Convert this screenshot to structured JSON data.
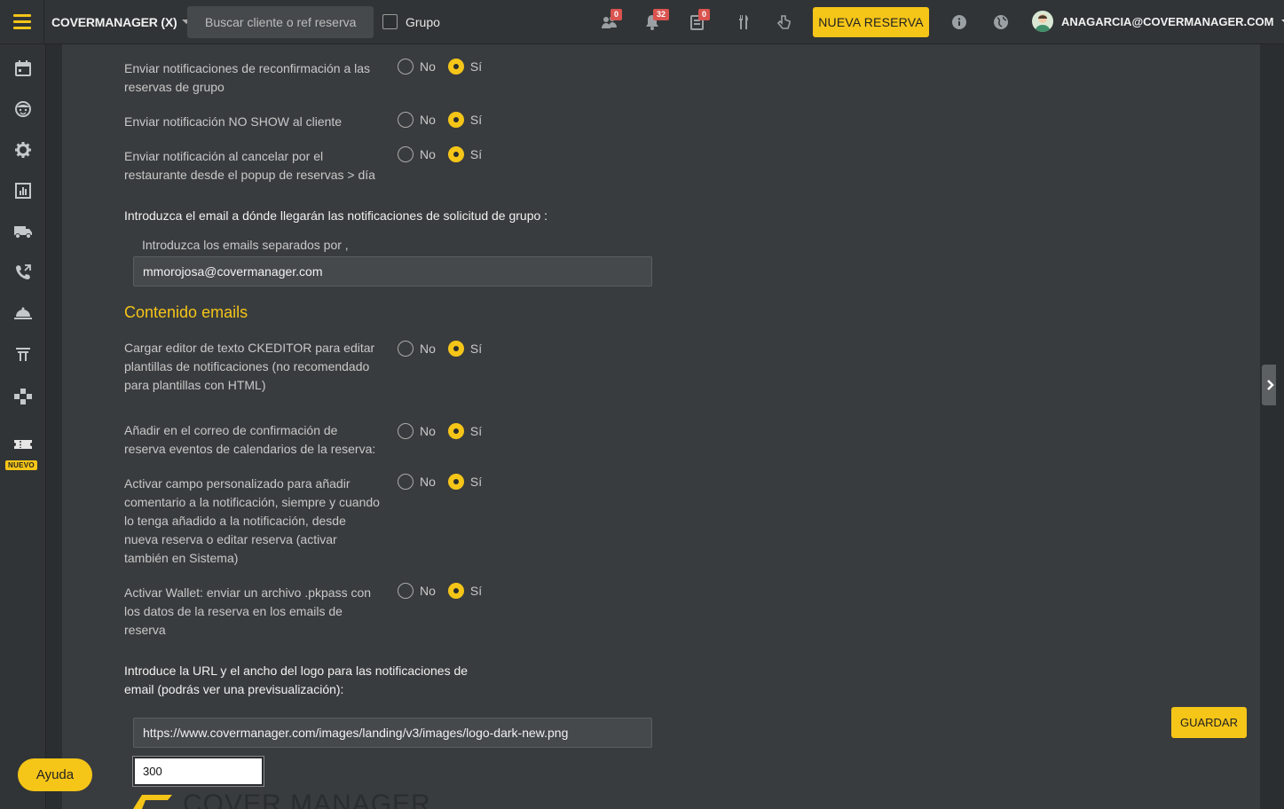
{
  "topbar": {
    "brand": "COVERMANAGER (X)",
    "search_placeholder": "Buscar cliente o ref reserva",
    "grupo_label": "Grupo",
    "badges": {
      "groups": "0",
      "alerts": "32",
      "tasks": "0"
    },
    "new_booking_label": "NUEVA RESERVA",
    "user_email": "ANAGARCIA@COVERMANAGER.COM"
  },
  "sidebar": {
    "items": [
      "calendar-icon",
      "face-icon",
      "gear-icon",
      "chart-icon",
      "truck-icon",
      "phone-icon",
      "cloche-icon",
      "pergola-icon",
      "gamepad-icon",
      "ticket-icon"
    ],
    "new_tag": "NUEVO"
  },
  "radio_labels": {
    "no": "No",
    "yes": "Sí"
  },
  "settings_top": [
    {
      "label": "Enviar notificaciones de reconfirmación a las reservas de grupo",
      "value": "Sí"
    },
    {
      "label": "Enviar notificación NO SHOW al cliente",
      "value": "Sí"
    },
    {
      "label": "Enviar notificación al cancelar por el restaurante desde el popup de reservas > día",
      "value": "Sí"
    }
  ],
  "group_email": {
    "heading": "Introduzca el email a dónde llegarán las notificaciones de solicitud de grupo :",
    "hint": "Introduzca los emails separados por ,",
    "value": "mmorojosa@covermanager.com"
  },
  "section_title": "Contenido emails",
  "settings_emails": [
    {
      "label": "Cargar editor de texto CKEDITOR para editar plantillas de notificaciones (no recomendado para plantillas con HTML)",
      "value": "Sí"
    },
    {
      "label": "Añadir en el correo de confirmación de reserva eventos de calendarios de la reserva:",
      "value": "Sí"
    },
    {
      "label": "Activar campo personalizado para añadir comentario a la notificación, siempre y cuando lo tenga añadido a la notificación, desde nueva reserva o editar reserva (activar también en Sistema)",
      "value": "Sí"
    },
    {
      "label": "Activar Wallet: enviar un archivo .pkpass con los datos de la reserva en los emails de reserva",
      "value": "Sí"
    }
  ],
  "logo": {
    "heading": "Introduce la URL y el ancho del logo para las notificaciones de email (podrás ver una previsualización):",
    "url": "https://www.covermanager.com/images/landing/v3/images/logo-dark-new.png",
    "width": "300",
    "preview_text": "COVER MANAGER"
  },
  "save_label": "GUARDAR",
  "help_label": "Ayuda",
  "colors": {
    "accent": "#f5c518",
    "panel": "#393c3e",
    "bg": "#2b2e30"
  }
}
